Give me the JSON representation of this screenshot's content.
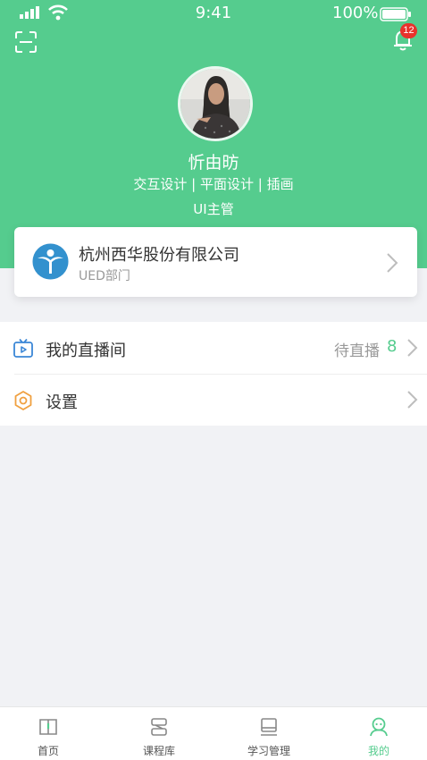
{
  "status_bar": {
    "time": "9:41",
    "battery": "100%"
  },
  "header": {
    "notification_count": "12"
  },
  "profile": {
    "name": "忻由昉",
    "roles": "交互设计 | 平面设计 | 插画",
    "position": "UI主管"
  },
  "company": {
    "name": "杭州西华股份有限公司",
    "department": "UED部门"
  },
  "menu": {
    "live_room": {
      "label": "我的直播间",
      "pending_label": "待直播",
      "pending_count": "8"
    },
    "settings": {
      "label": "设置"
    }
  },
  "tabs": [
    {
      "label": "首页",
      "icon": "book-icon"
    },
    {
      "label": "课程库",
      "icon": "library-icon"
    },
    {
      "label": "学习管理",
      "icon": "study-icon"
    },
    {
      "label": "我的",
      "icon": "user-icon"
    }
  ],
  "colors": {
    "brand": "#55cc8e",
    "badge": "#e8322c"
  }
}
